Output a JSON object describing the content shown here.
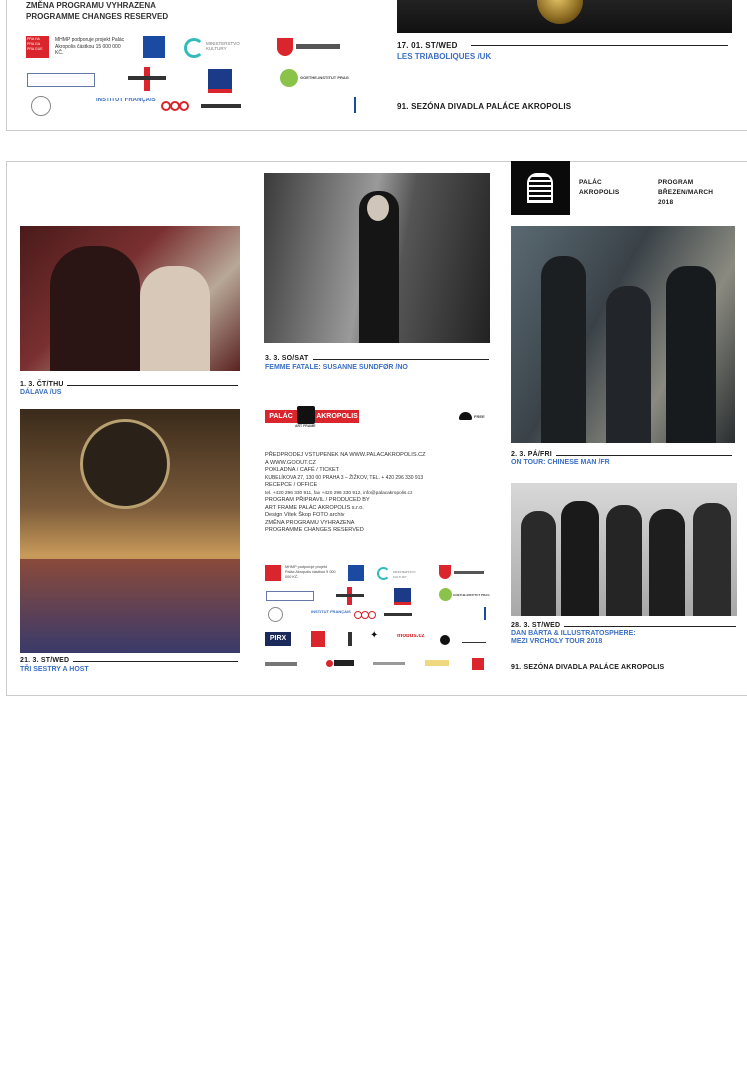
{
  "top_panel": {
    "reserved_lines": [
      "ZMĚNA PROGRAMU VYHRAZENA",
      "PROGRAMME CHANGES RESERVED"
    ],
    "mhmp_text": "MHMP podporuje projekt Palác Akropolis částkou 15 000 000 KČ.",
    "ministry_text": "MINISTERSTVO KULTURY",
    "goethe_text": "GOETHE-INSTITUT PRAG",
    "institut_text": "INSTITUT FRANÇAIS",
    "event_date": "17. 01. ST/WED",
    "event_title": "LES TRIABOLIQUES /UK",
    "season": "91. SEZÓNA DIVADLA PALÁCE AKROPOLIS"
  },
  "header": {
    "venue": [
      "PALÁC",
      "AKROPOLIS"
    ],
    "program": [
      "PROGRAM",
      "BŘEZEN/MARCH",
      "2018"
    ]
  },
  "events": {
    "dalava": {
      "date": "1. 3. ČT/THU",
      "title": "DÁLAVA /US"
    },
    "sestry": {
      "date": "21. 3.  ST/WED",
      "title": "TŘI SESTRY A HOST"
    },
    "sundfor": {
      "date": "3. 3. SO/SAT",
      "title": "FEMME FATALE:  SUSANNE SUNDFØR /NO"
    },
    "chineseman": {
      "date": "2. 3. PÁ/FRI",
      "title": "ON TOUR: CHINESE MAN /FR"
    },
    "barta": {
      "date": "28. 3. ST/WED",
      "title_lines": [
        "DAN BÁRTA & ILLUSTRATOSPHERE:",
        "MEZI VRCHOLY TOUR 2018"
      ]
    }
  },
  "middle": {
    "logo_left": "PALÁC",
    "logo_right": "AKROPOLIS",
    "logo_sub": "ART FRAME",
    "wifi_text": "FREE",
    "info_lines": [
      "PŘEDPRODEJ VSTUPENEK NA WWW.PALACAKROPOLIS.CZ",
      "A WWW.GOOUT.CZ",
      "POKLADNA / CAFÉ / TICKET",
      "KUBELÍKOVA 27, 130 00 PRAHA 3 – ŽIŽKOV, TEL. + 420 296 330 913",
      "RECEPCE / OFFICE",
      "tel. +420 296 330 911, fax +420 296 330 912, info@palacakropolis.cz",
      "PROGRAM PŘIPRAVIL / PRODUCED BY",
      "ART FRAME PALÁC AKROPOLIS s.r.o.",
      "Design Vítek Škop FOTO archiv",
      "ZMĚNA PROGRAMU VYHRAZENA",
      "PROGRAMME CHANGES RESERVED"
    ],
    "mhmp_text": "MHMP podporuje projekt Palác Akropolis částkou 9 000 000 KČ.",
    "pirx": "PIRX",
    "mobus": "mobus.cz"
  },
  "season_footer": "91. SEZÓNA DIVADLA PALÁCE AKROPOLIS",
  "colors": {
    "accent_blue": "#3b6fc4",
    "brand_red": "#d9252b"
  }
}
